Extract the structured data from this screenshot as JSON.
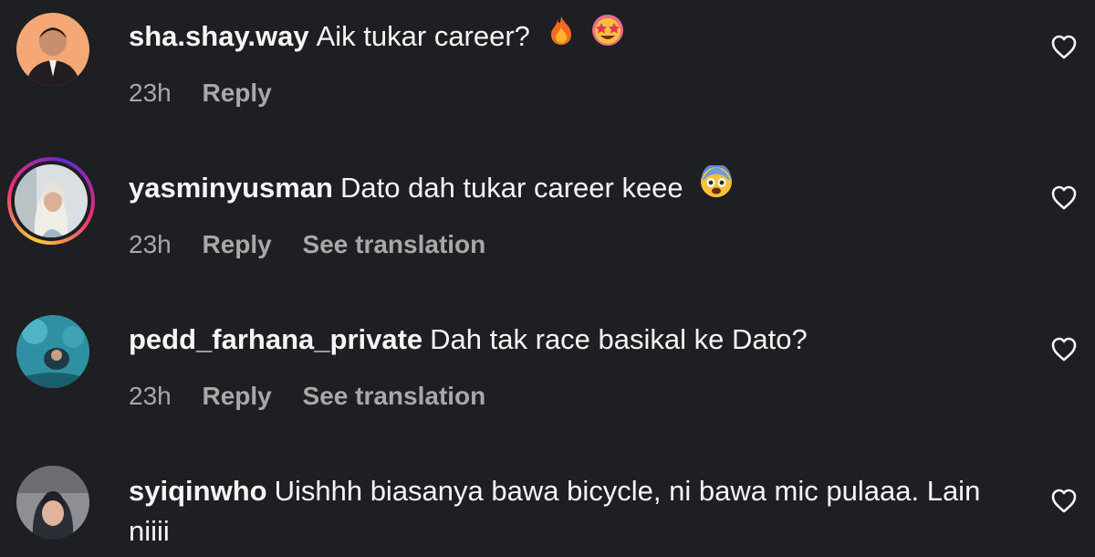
{
  "comments": [
    {
      "username": "sha.shay.way",
      "text": "Aik tukar career?",
      "emojis": [
        "fire-emoji",
        "star-struck-emoji"
      ],
      "time": "23h",
      "reply": "Reply",
      "translate": ""
    },
    {
      "username": "yasminyusman",
      "text": "Dato dah tukar career keee",
      "emojis": [
        "fearful-face-emoji"
      ],
      "time": "23h",
      "reply": "Reply",
      "translate": "See translation"
    },
    {
      "username": "pedd_farhana_private",
      "text": "Dah tak race basikal ke Dato?",
      "emojis": [],
      "time": "23h",
      "reply": "Reply",
      "translate": "See translation"
    },
    {
      "username": "syiqinwho",
      "text": "Uishhh biasanya bawa bicycle, ni bawa mic pulaaa. Lain niiii",
      "emojis": [],
      "time": "",
      "reply": "",
      "translate": ""
    }
  ],
  "colors": {
    "background": "#1e1f22",
    "text": "#f5f5f5",
    "meta": "#a8a8a8"
  }
}
